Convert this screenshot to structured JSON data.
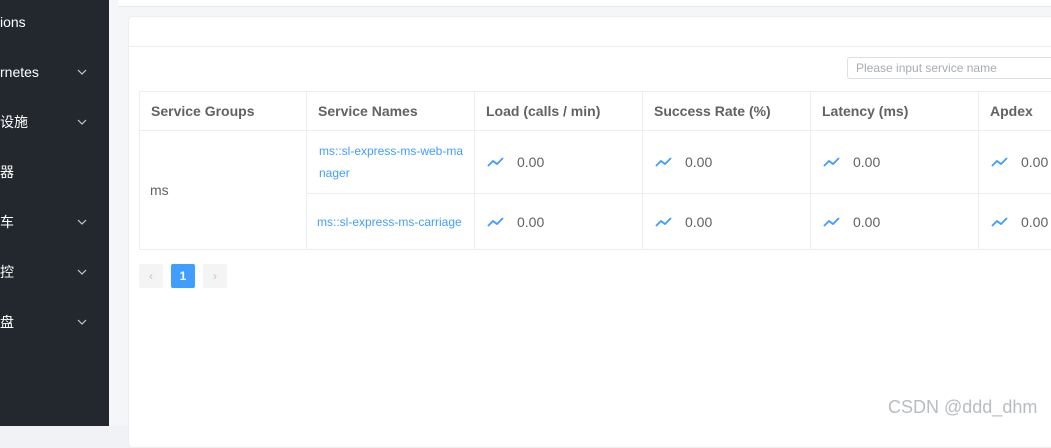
{
  "sidebar": {
    "items": [
      {
        "label": "ions",
        "chevron": false
      },
      {
        "label": "rnetes",
        "chevron": true
      },
      {
        "label": "设施",
        "chevron": true
      },
      {
        "label": "器",
        "chevron": false
      },
      {
        "label": "车",
        "chevron": true
      },
      {
        "label": "控",
        "chevron": true
      },
      {
        "label": "盘",
        "chevron": true
      }
    ]
  },
  "search": {
    "placeholder": "Please input service name",
    "value": ""
  },
  "table": {
    "headers": [
      "Service Groups",
      "Service Names",
      "Load (calls / min)",
      "Success Rate (%)",
      "Latency (ms)",
      "Apdex"
    ],
    "group": "ms",
    "rows": [
      {
        "name": "ms::sl-express-ms-web-manager",
        "load": "0.00",
        "success_rate": "0.00",
        "latency": "0.00",
        "apdex": "0.00"
      },
      {
        "name": "ms::sl-express-ms-carriage",
        "load": "0.00",
        "success_rate": "0.00",
        "latency": "0.00",
        "apdex": "0.00"
      }
    ]
  },
  "pagination": {
    "prev": "‹",
    "current": "1",
    "next": "›"
  },
  "icons": {
    "trend": "line-chart-icon",
    "chevron": "chevron-down-icon"
  },
  "colors": {
    "accent": "#409eff",
    "sidebar": "#23272e"
  },
  "watermark": "CSDN @ddd_dhm"
}
